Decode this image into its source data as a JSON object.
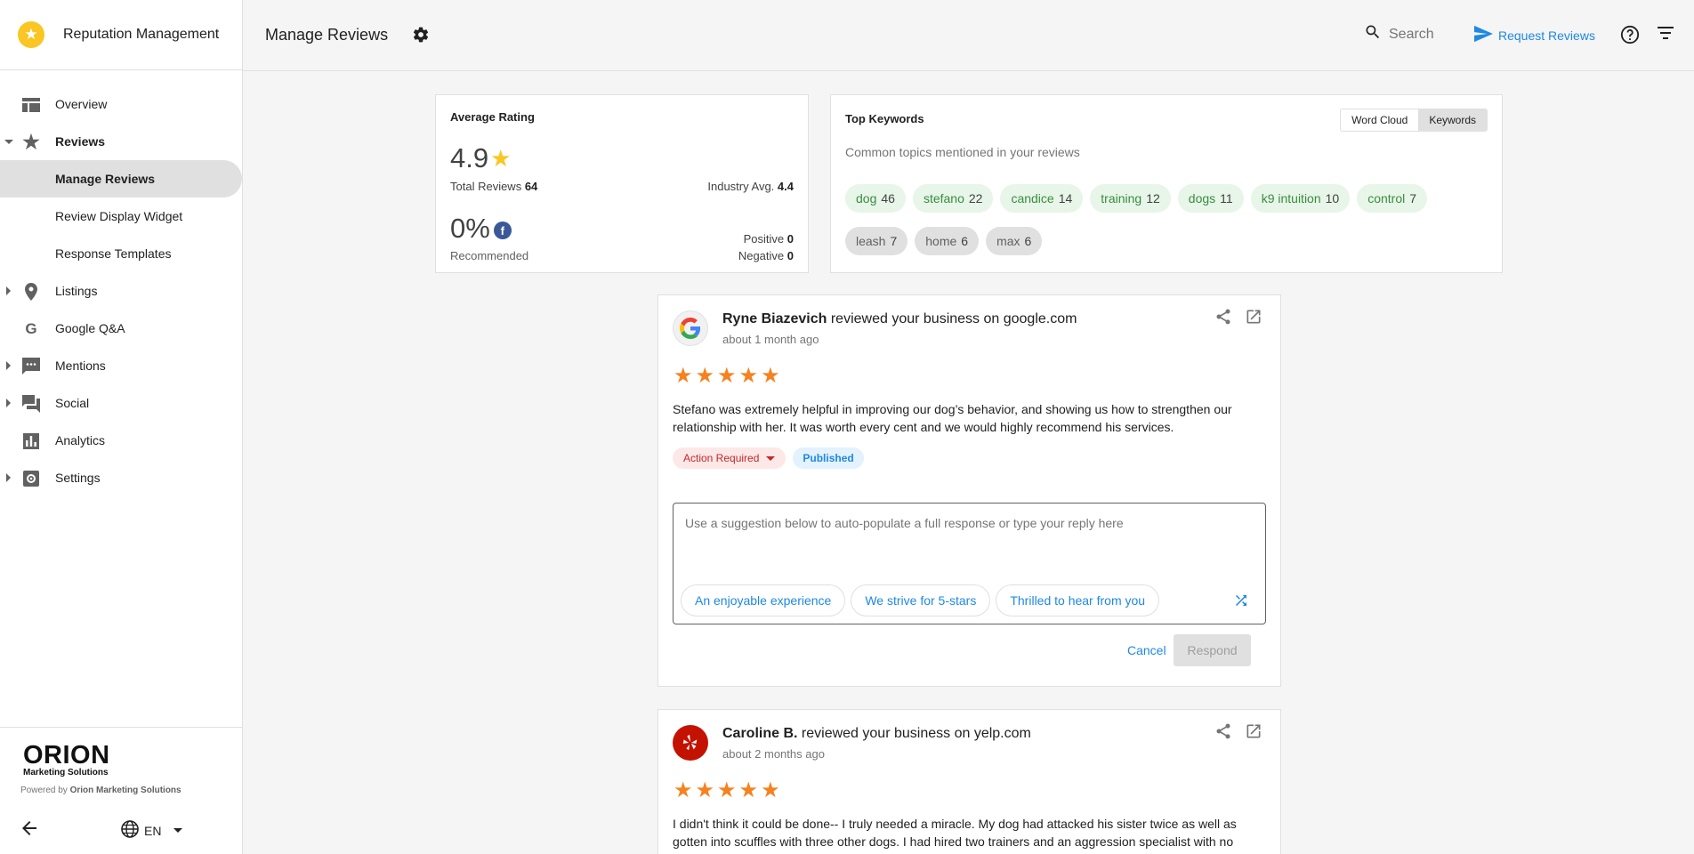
{
  "app": {
    "title": "Reputation Management"
  },
  "sidebar": {
    "items": [
      {
        "label": "Overview"
      },
      {
        "label": "Reviews"
      },
      {
        "label": "Manage Reviews"
      },
      {
        "label": "Review Display Widget"
      },
      {
        "label": "Response Templates"
      },
      {
        "label": "Listings"
      },
      {
        "label": "Google Q&A"
      },
      {
        "label": "Mentions"
      },
      {
        "label": "Social"
      },
      {
        "label": "Analytics"
      },
      {
        "label": "Settings"
      }
    ],
    "brand": {
      "name": "ORION",
      "sub": "Marketing Solutions"
    },
    "powered_prefix": "Powered by",
    "powered_by": "Orion Marketing Solutions",
    "language": "EN"
  },
  "header": {
    "title": "Manage Reviews",
    "search_placeholder": "Search",
    "request_reviews": "Request Reviews"
  },
  "avg_rating": {
    "title": "Average Rating",
    "value": "4.9",
    "total_label": "Total Reviews",
    "total": "64",
    "industry_label": "Industry Avg.",
    "industry": "4.4",
    "recommended_pct": "0%",
    "recommended_label": "Recommended",
    "positive_label": "Positive",
    "positive": "0",
    "negative_label": "Negative",
    "negative": "0"
  },
  "keywords": {
    "title": "Top Keywords",
    "subtitle": "Common topics mentioned in your reviews",
    "toggle": [
      "Word Cloud",
      "Keywords"
    ],
    "chips": [
      {
        "word": "dog",
        "count": "46",
        "tone": "positive"
      },
      {
        "word": "stefano",
        "count": "22",
        "tone": "positive"
      },
      {
        "word": "candice",
        "count": "14",
        "tone": "positive"
      },
      {
        "word": "training",
        "count": "12",
        "tone": "positive"
      },
      {
        "word": "dogs",
        "count": "11",
        "tone": "positive"
      },
      {
        "word": "k9 intuition",
        "count": "10",
        "tone": "positive"
      },
      {
        "word": "control",
        "count": "7",
        "tone": "positive"
      },
      {
        "word": "leash",
        "count": "7",
        "tone": "neutral"
      },
      {
        "word": "home",
        "count": "6",
        "tone": "neutral"
      },
      {
        "word": "max",
        "count": "6",
        "tone": "neutral"
      }
    ]
  },
  "reviews": [
    {
      "author": "Ryne Biazevich",
      "action": "reviewed your business on",
      "site": "google.com",
      "time": "about 1 month ago",
      "stars": 5,
      "text": "Stefano was extremely helpful in improving our dog’s behavior, and showing us how to strengthen our relationship with her. It was worth every cent and we would highly recommend his services.",
      "status_action": "Action Required",
      "status_pub": "Published",
      "reply_placeholder": "Use a suggestion below to auto-populate a full response or type your reply here",
      "suggestions": [
        "An enjoyable experience",
        "We strive for 5-stars",
        "Thrilled to hear from you"
      ],
      "cancel": "Cancel",
      "respond": "Respond"
    },
    {
      "author": "Caroline B.",
      "action": "reviewed your business on",
      "site": "yelp.com",
      "time": "about 2 months ago",
      "stars": 5,
      "text": "I didn't think it could be done-- I truly needed a miracle. My dog had attacked his sister twice as well as gotten into scuffles with three other dogs. I had hired two trainers and an aggression specialist with no"
    }
  ]
}
